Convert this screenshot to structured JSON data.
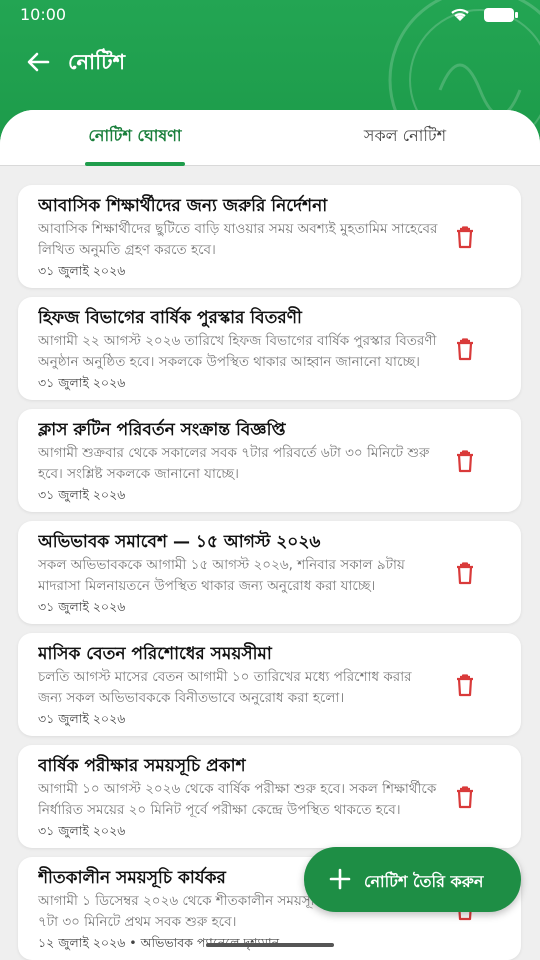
{
  "status_bar": {
    "time": "10:00"
  },
  "appbar": {
    "title": "নোটিশ"
  },
  "tabs": [
    {
      "label": "নোটিশ ঘোষণা",
      "active": true
    },
    {
      "label": "সকল নোটিশ",
      "active": false
    }
  ],
  "notices": [
    {
      "title": "আবাসিক শিক্ষার্থীদের জন্য জরুরি নির্দেশনা",
      "body": "আবাসিক শিক্ষার্থীদের ছুটিতে বাড়ি যাওয়ার সময় অবশ্যই মুহতামিম সাহেবের লিখিত অনুমতি গ্রহণ করতে হবে।",
      "date": "৩১ জুলাই ২০২৬"
    },
    {
      "title": "হিফজ বিভাগের বার্ষিক পুরস্কার বিতরণী",
      "body": "আগামী ২২ আগস্ট ২০২৬ তারিখে হিফজ বিভাগের বার্ষিক পুরস্কার বিতরণী অনুষ্ঠান অনুষ্ঠিত হবে। সকলকে উপস্থিত থাকার আহ্বান জানানো যাচ্ছে।",
      "date": "৩১ জুলাই ২০২৬"
    },
    {
      "title": "ক্লাস রুটিন পরিবর্তন সংক্রান্ত বিজ্ঞপ্তি",
      "body": "আগামী শুক্রবার থেকে সকালের সবক ৭টার পরিবর্তে ৬টা ৩০ মিনিটে শুরু হবে। সংশ্লিষ্ট সকলকে জানানো যাচ্ছে।",
      "date": "৩১ জুলাই ২০২৬"
    },
    {
      "title": "অভিভাবক সমাবেশ — ১৫ আগস্ট ২০২৬",
      "body": "সকল অভিভাবককে আগামী ১৫ আগস্ট ২০২৬, শনিবার সকাল ৯টায় মাদরাসা মিলনায়তনে উপস্থিত থাকার জন্য অনুরোধ করা যাচ্ছে।",
      "date": "৩১ জুলাই ২০২৬"
    },
    {
      "title": "মাসিক বেতন পরিশোধের সময়সীমা",
      "body": "চলতি আগস্ট মাসের বেতন আগামী ১০ তারিখের মধ্যে পরিশোধ করার জন্য সকল অভিভাবককে বিনীতভাবে অনুরোধ করা হলো।",
      "date": "৩১ জুলাই ২০২৬"
    },
    {
      "title": "বার্ষিক পরীক্ষার সময়সূচি প্রকাশ",
      "body": "আগামী ১০ আগস্ট ২০২৬ থেকে বার্ষিক পরীক্ষা শুরু হবে। সকল শিক্ষার্থীকে নির্ধারিত সময়ের ২০ মিনিট পূর্বে পরীক্ষা কেন্দ্রে উপস্থিত থাকতে হবে।",
      "date": "৩১ জুলাই ২০২৬"
    },
    {
      "title": "শীতকালীন সময়সূচি কার্যকর",
      "body": "আগামী ১ ডিসেম্বর ২০২৬ থেকে শীতকালীন সময়সূচি কার্যকর হবে। সকাল ৭টা ৩০ মিনিটে প্রথম সবক শুরু হবে।",
      "date": "১২ জুলাই ২০২৬ • অভিভাবক প্যানেলে দৃশ্যমান"
    }
  ],
  "fab": {
    "label": "নোটিশ তৈরি করুন"
  },
  "colors": {
    "primary": "#1f9d4c",
    "delete": "#d93a3a"
  }
}
